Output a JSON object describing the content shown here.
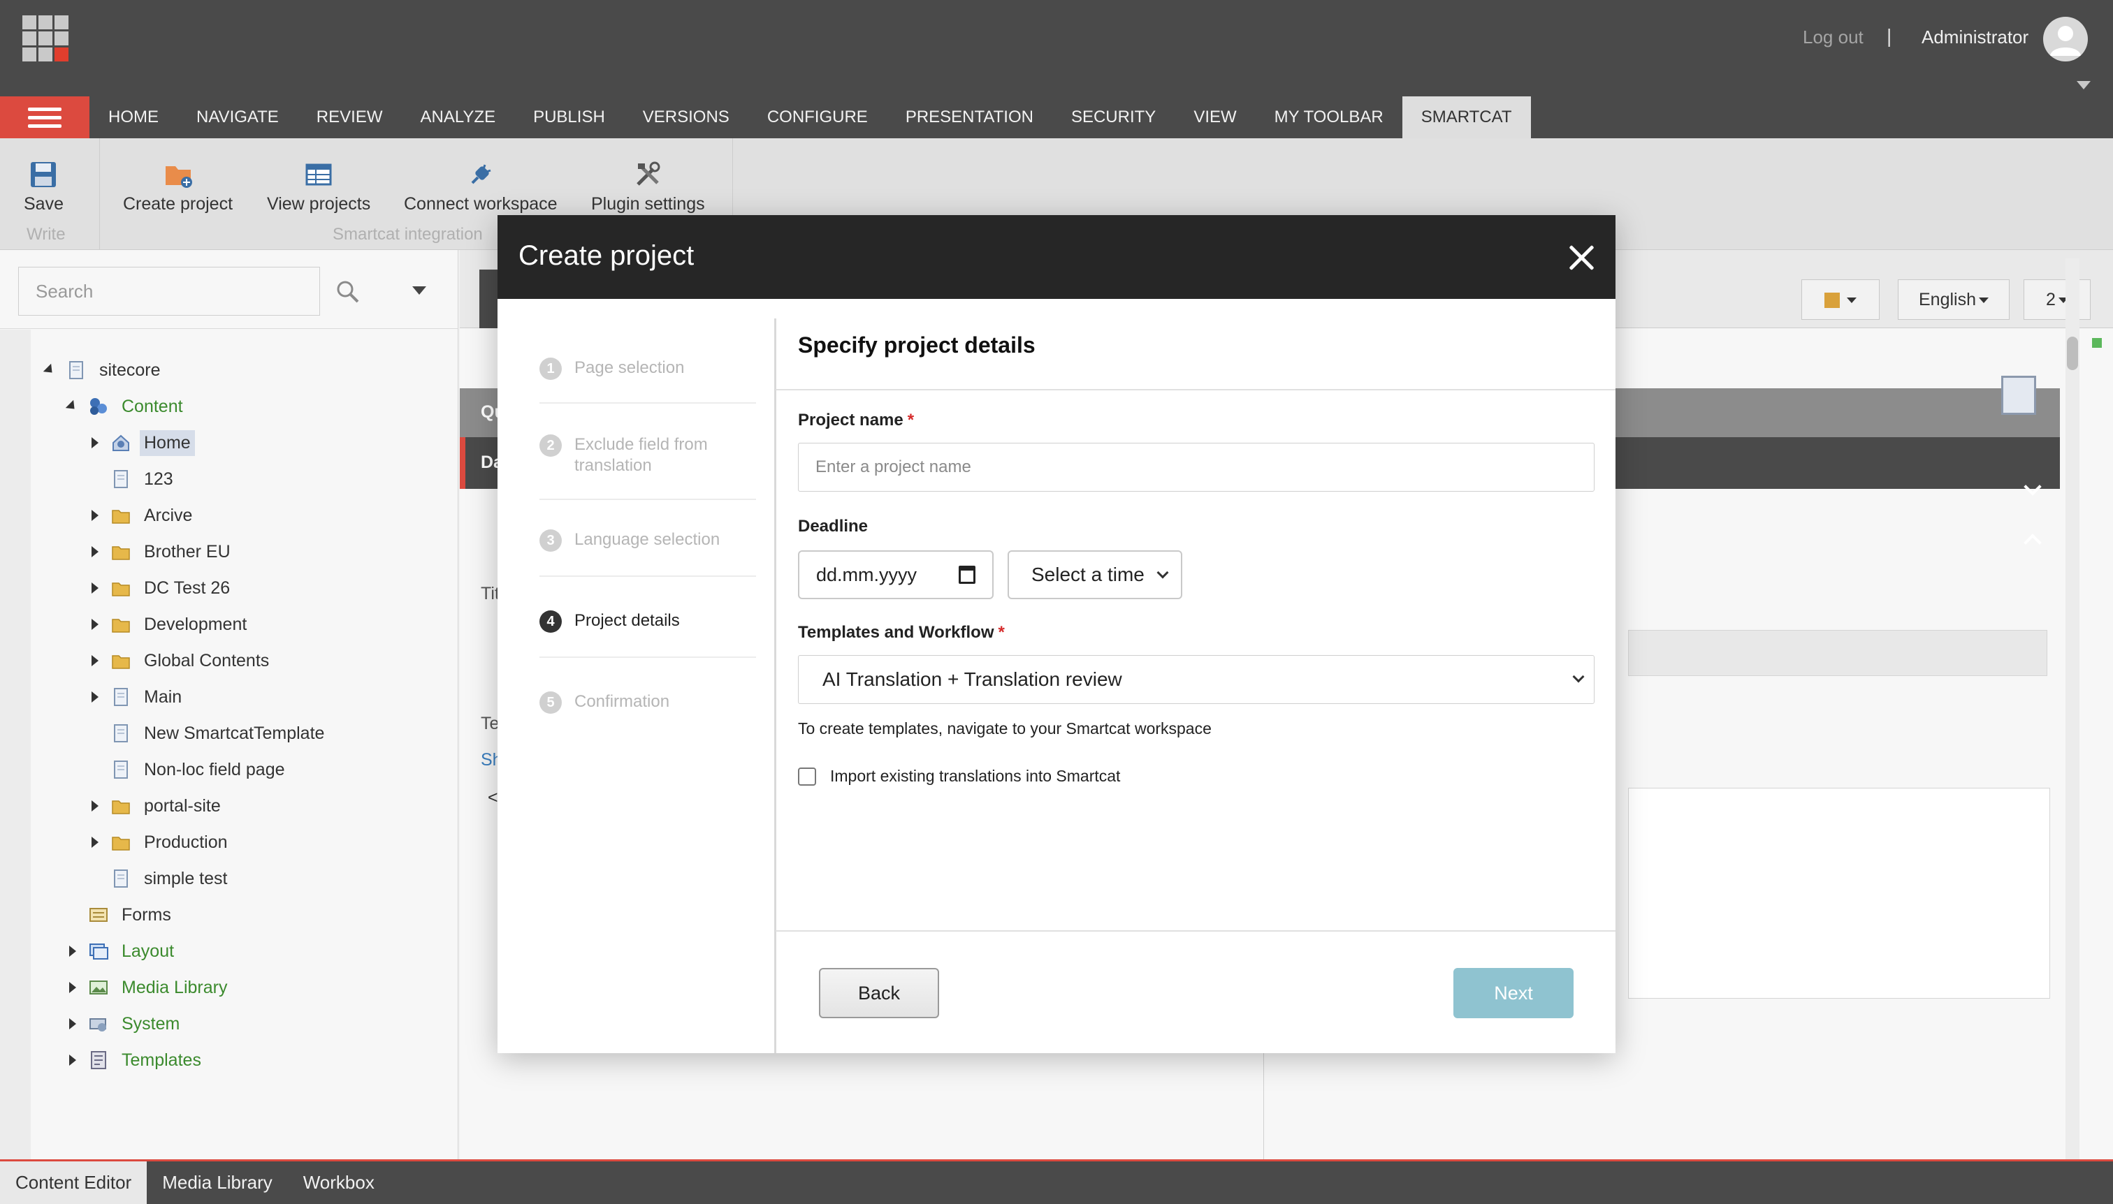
{
  "topbar": {
    "logout": "Log out",
    "separator": "|",
    "username": "Administrator"
  },
  "ribbon": {
    "tabs": [
      "HOME",
      "NAVIGATE",
      "REVIEW",
      "ANALYZE",
      "PUBLISH",
      "VERSIONS",
      "CONFIGURE",
      "PRESENTATION",
      "SECURITY",
      "VIEW",
      "MY TOOLBAR",
      "SMARTCAT"
    ],
    "active_tab": "SMARTCAT",
    "buttons": {
      "save": "Save",
      "create_project": "Create project",
      "view_projects": "View projects",
      "connect_workspace": "Connect workspace",
      "plugin_settings": "Plugin settings"
    },
    "groups": {
      "write": "Write",
      "smartcat": "Smartcat integration"
    }
  },
  "tree": {
    "search_placeholder": "Search",
    "nodes": {
      "sitecore": "sitecore",
      "content": "Content",
      "home": "Home",
      "n123": "123",
      "arcive": "Arcive",
      "brother": "Brother EU",
      "dctest": "DC Test 26",
      "development": "Development",
      "global": "Global Contents",
      "main": "Main",
      "newsmartcat": "New SmartcatTemplate",
      "nonloc": "Non-loc field page",
      "portal": "portal-site",
      "production": "Production",
      "simpletest": "simple test",
      "forms": "Forms",
      "layout": "Layout",
      "media": "Media Library",
      "system": "System",
      "templates": "Templates"
    }
  },
  "editor": {
    "language": "English",
    "version": "2",
    "partial_labels": {
      "qu": "Qu",
      "da": "Da",
      "tit": "Tit",
      "te": "Te",
      "sh": "Sh",
      "lt": "<"
    }
  },
  "bottombar": {
    "tabs": [
      "Content Editor",
      "Media Library",
      "Workbox"
    ],
    "active": "Content Editor"
  },
  "modal": {
    "title": "Create project",
    "steps": [
      {
        "num": "1",
        "label": "Page selection"
      },
      {
        "num": "2",
        "label": "Exclude field from translation"
      },
      {
        "num": "3",
        "label": "Language selection"
      },
      {
        "num": "4",
        "label": "Project details"
      },
      {
        "num": "5",
        "label": "Confirmation"
      }
    ],
    "active_step": 4,
    "form": {
      "heading": "Specify project details",
      "project_name_label": "Project name",
      "required_mark": "*",
      "project_name_placeholder": "Enter a project name",
      "project_name_value": "",
      "deadline_label": "Deadline",
      "date_value": "dd.mm.yyyy",
      "time_value": "Select a time",
      "templates_label": "Templates and Workflow",
      "workflow_value": "AI Translation + Translation review",
      "templates_hint": "To create templates, navigate to your Smartcat workspace",
      "import_label": "Import existing translations into Smartcat",
      "import_checked": false
    },
    "buttons": {
      "back": "Back",
      "next": "Next"
    }
  },
  "colors": {
    "accent_red": "#dc4a3f",
    "tree_green": "#3b8a2d",
    "next_disabled": "#8fc3d0",
    "modal_header": "#262626"
  }
}
